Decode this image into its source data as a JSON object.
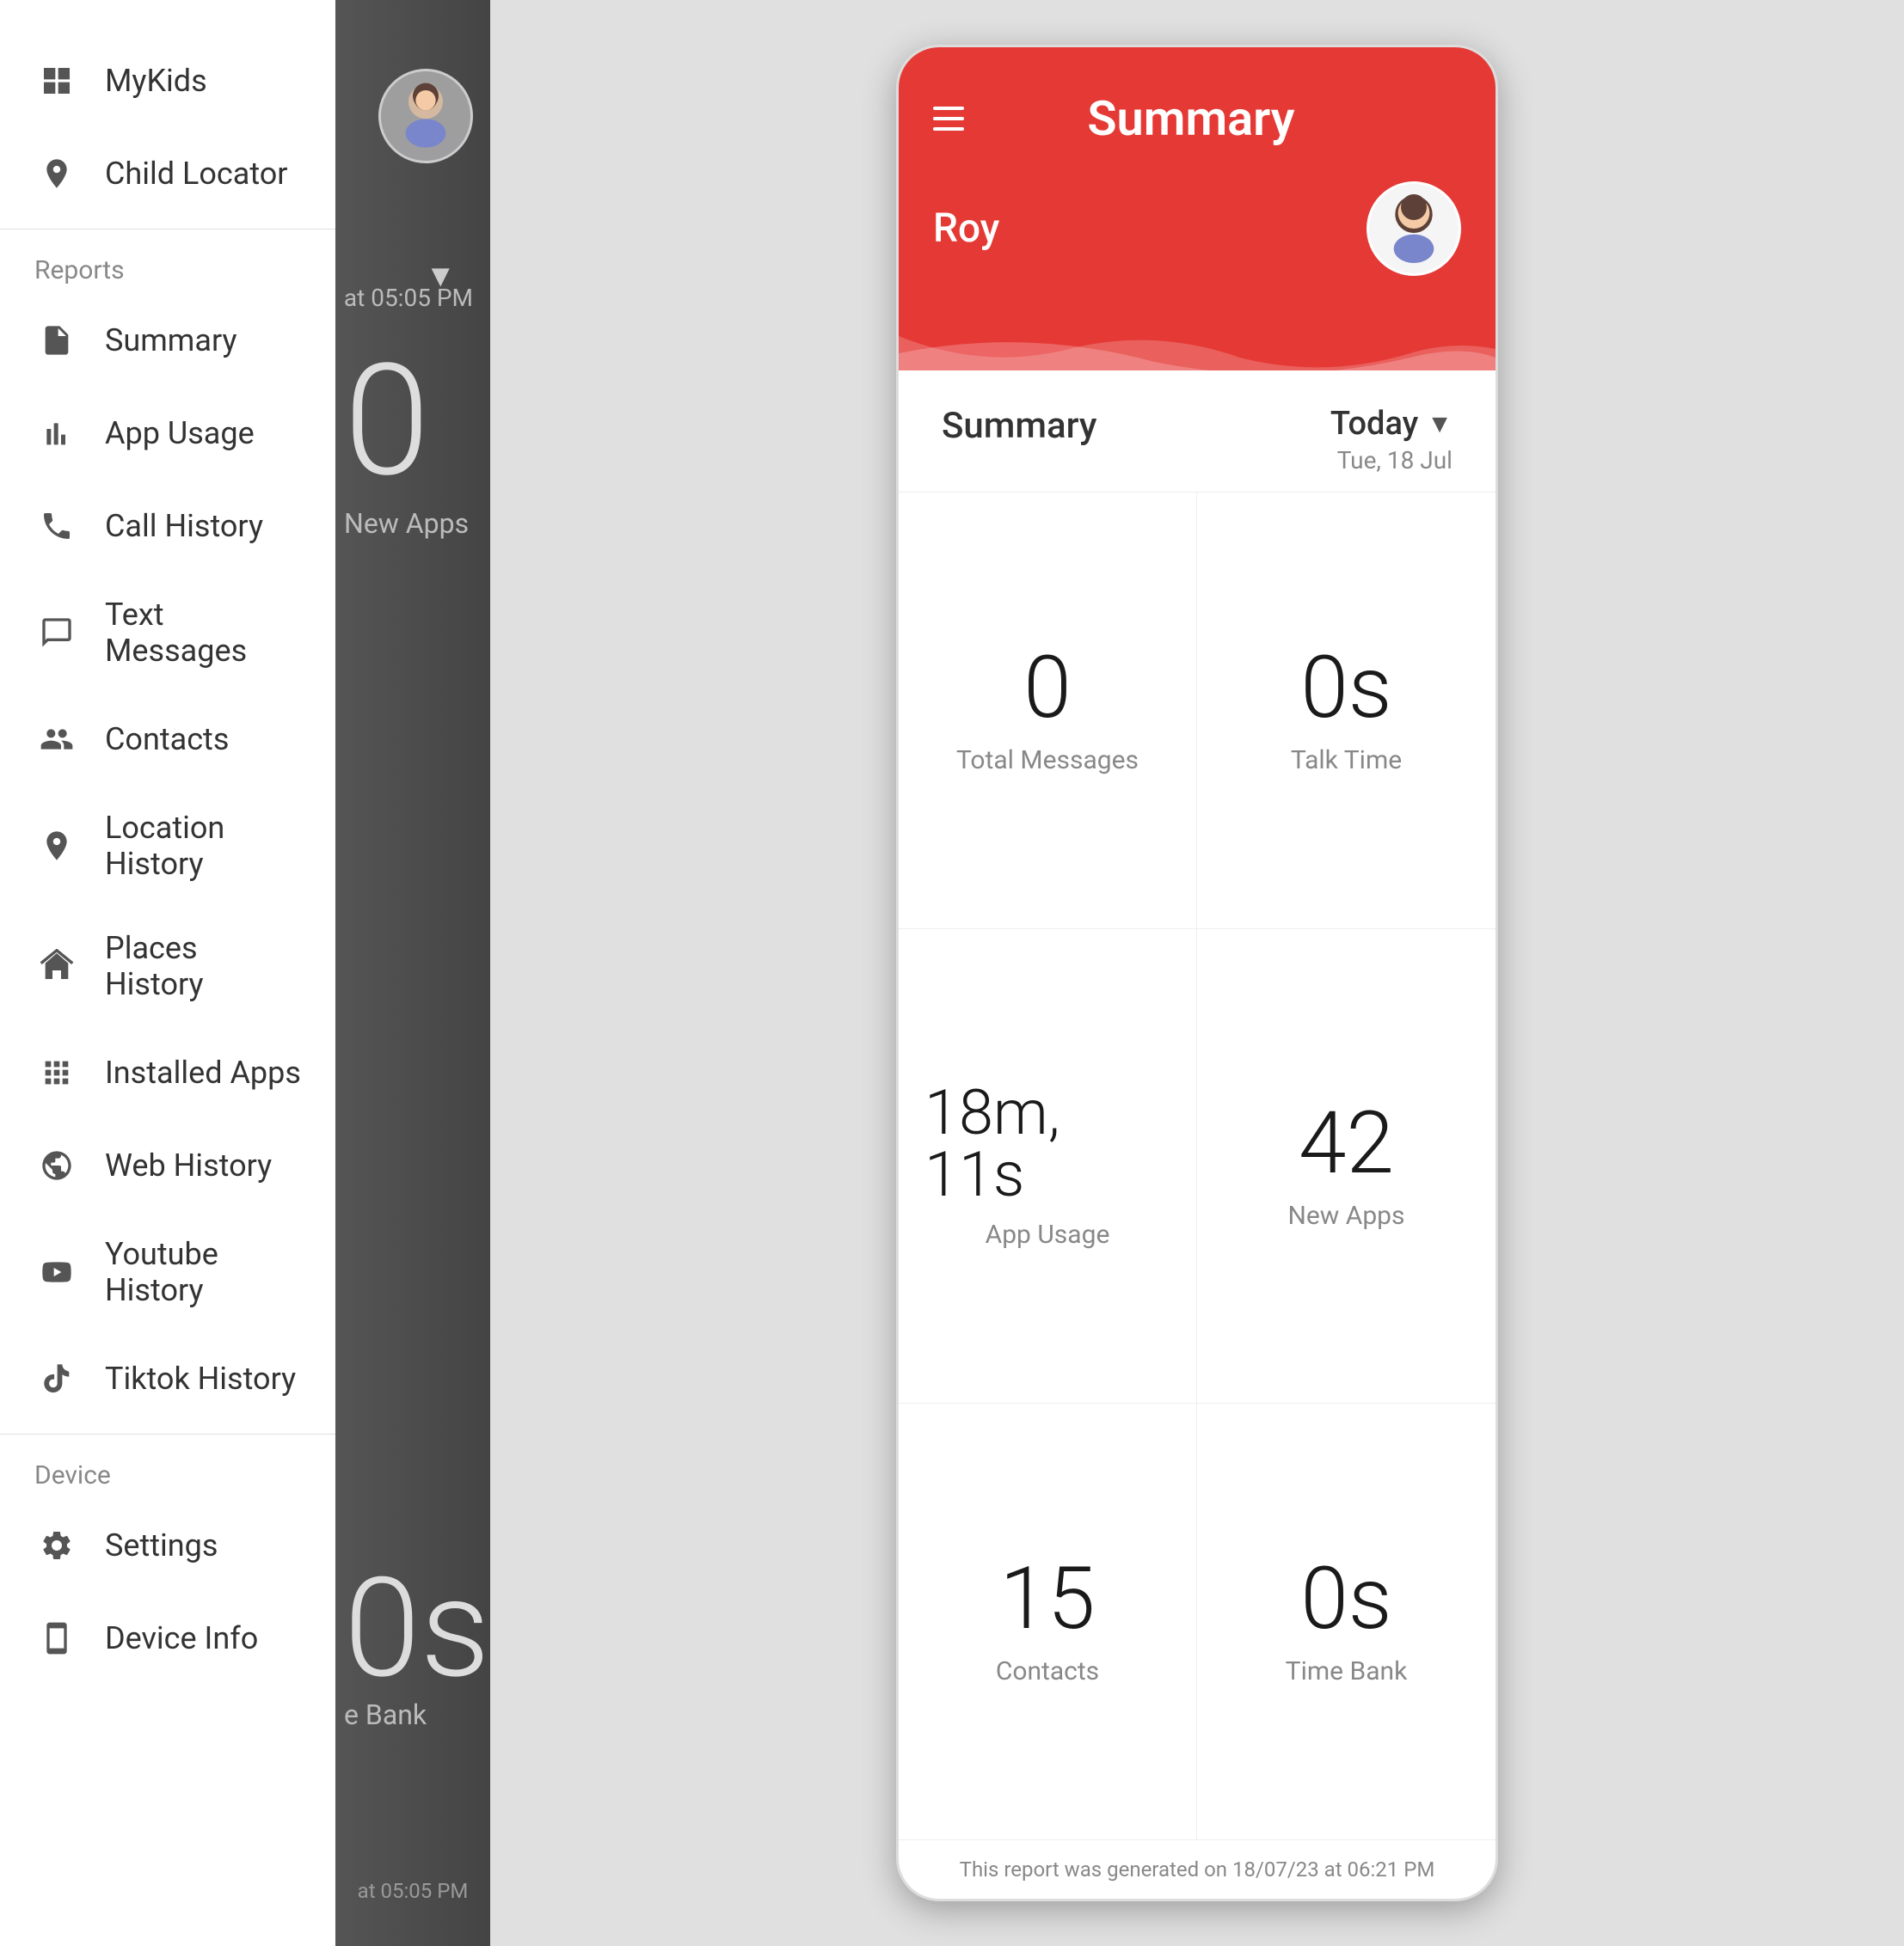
{
  "sidebar": {
    "items_top": [
      {
        "id": "mykids",
        "label": "MyKids",
        "icon": "grid"
      },
      {
        "id": "child-locator",
        "label": "Child Locator",
        "icon": "location-pin"
      }
    ],
    "section_reports": "Reports",
    "items_reports": [
      {
        "id": "summary",
        "label": "Summary",
        "icon": "document"
      },
      {
        "id": "app-usage",
        "label": "App Usage",
        "icon": "bar-chart"
      },
      {
        "id": "call-history",
        "label": "Call History",
        "icon": "phone"
      },
      {
        "id": "text-messages",
        "label": "Text Messages",
        "icon": "message"
      },
      {
        "id": "contacts",
        "label": "Contacts",
        "icon": "people"
      },
      {
        "id": "location-history",
        "label": "Location History",
        "icon": "map-pin"
      },
      {
        "id": "places-history",
        "label": "Places History",
        "icon": "building"
      },
      {
        "id": "installed-apps",
        "label": "Installed Apps",
        "icon": "grid-dots"
      },
      {
        "id": "web-history",
        "label": "Web History",
        "icon": "globe"
      },
      {
        "id": "youtube-history",
        "label": "Youtube History",
        "icon": "youtube"
      },
      {
        "id": "tiktok-history",
        "label": "Tiktok History",
        "icon": "tiktok"
      }
    ],
    "section_device": "Device",
    "items_device": [
      {
        "id": "settings",
        "label": "Settings",
        "icon": "gear"
      },
      {
        "id": "device-info",
        "label": "Device Info",
        "icon": "device"
      }
    ]
  },
  "overlay": {
    "big_number": "0",
    "new_apps_label": "New Apps",
    "zero_bottom": "0s",
    "bank_label": "e Bank",
    "footer_text": "at  05:05 PM"
  },
  "app": {
    "header": {
      "title": "Summary",
      "user_name": "Roy"
    },
    "summary_label": "Summary",
    "date": {
      "period": "Today",
      "date_sub": "Tue, 18 Jul"
    },
    "stats": [
      {
        "value": "0",
        "label": "Total Messages"
      },
      {
        "value": "0s",
        "label": "Talk Time"
      },
      {
        "value": "18m, 11s",
        "label": "App Usage"
      },
      {
        "value": "42",
        "label": "New Apps"
      },
      {
        "value": "15",
        "label": "Contacts"
      },
      {
        "value": "0s",
        "label": "Time Bank"
      }
    ],
    "footer": "This report was generated on 18/07/23  at  06:21 PM"
  }
}
